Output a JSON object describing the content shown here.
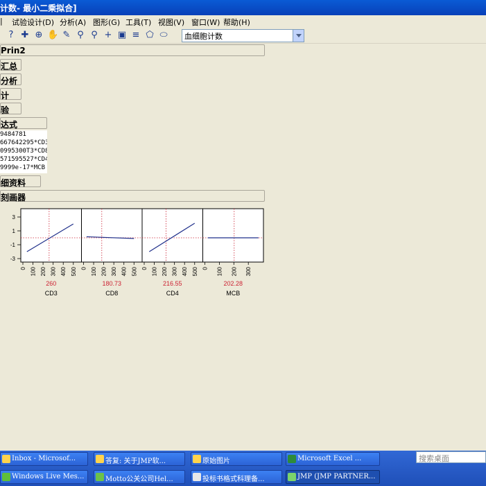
{
  "window": {
    "title": "计数- 最小二乘拟合]"
  },
  "menu": [
    "试验设计(D)",
    "分析(A)",
    "图形(G)",
    "工具(T)",
    "视图(V)",
    "窗口(W)",
    "帮助(H)"
  ],
  "toolbar": {
    "combo_value": "血细胞计数"
  },
  "outline": {
    "prin2": "Prin2",
    "summary": "汇总",
    "analysis": "分析",
    "estimates": "计",
    "test": "验",
    "expression": "达式",
    "details": "细资料",
    "profiler": "刻画器"
  },
  "formula_lines": [
    "9484781",
    "667642295*CD3",
    "0995300T3*CD8",
    "571595527*CD4",
    "9999e-17*MCB"
  ],
  "chart_data": {
    "type": "line",
    "title": "",
    "ylabel": "",
    "ylim": [
      -3.5,
      4.2
    ],
    "yticks": [
      "3",
      "1",
      "-1",
      "-3"
    ],
    "yticks_values": [
      3,
      1,
      -1,
      -3
    ],
    "y_current": 0,
    "panels": [
      {
        "xlabel": "CD3",
        "current_label": "260",
        "current": 260,
        "xlim": [
          0,
          560
        ],
        "xticks": [
          "0",
          "100",
          "200",
          "300",
          "400",
          "500"
        ],
        "line": [
          [
            40,
            -2.0
          ],
          [
            500,
            2.0
          ]
        ]
      },
      {
        "xlabel": "CD8",
        "current_label": "180.73",
        "current": 180.73,
        "xlim": [
          0,
          560
        ],
        "xticks": [
          "0",
          "100",
          "200",
          "300",
          "400",
          "500"
        ],
        "line": [
          [
            30,
            0.15
          ],
          [
            500,
            -0.1
          ]
        ]
      },
      {
        "xlabel": "CD4",
        "current_label": "216.55",
        "current": 216.55,
        "xlim": [
          0,
          560
        ],
        "xticks": [
          "0",
          "100",
          "200",
          "300",
          "400",
          "500"
        ],
        "line": [
          [
            50,
            -2.0
          ],
          [
            500,
            2.1
          ]
        ]
      },
      {
        "xlabel": "MCB",
        "current_label": "202.28",
        "current": 202.28,
        "xlim": [
          0,
          390
        ],
        "xticks": [
          "0",
          "100",
          "200",
          "300"
        ],
        "line": [
          [
            20,
            0
          ],
          [
            370,
            0
          ]
        ]
      }
    ]
  },
  "taskbar": {
    "row1": [
      "Inbox - Microsof...",
      "答复: 关于JMP软...",
      "原始图片",
      "Microsoft Excel ..."
    ],
    "row2": [
      "Windows Live Mes...",
      "Motto公关公司Hel...",
      "投标书格式科理备...",
      "JMP (JMP PARTNER..."
    ]
  },
  "search_placeholder": "搜索桌面",
  "colors": {
    "title_bar": "#0A5BD5",
    "taskbar": "#3168D5",
    "profile_line": "#1F2F8A",
    "crosshair": "#CC2233",
    "value_text": "#CC2233"
  }
}
